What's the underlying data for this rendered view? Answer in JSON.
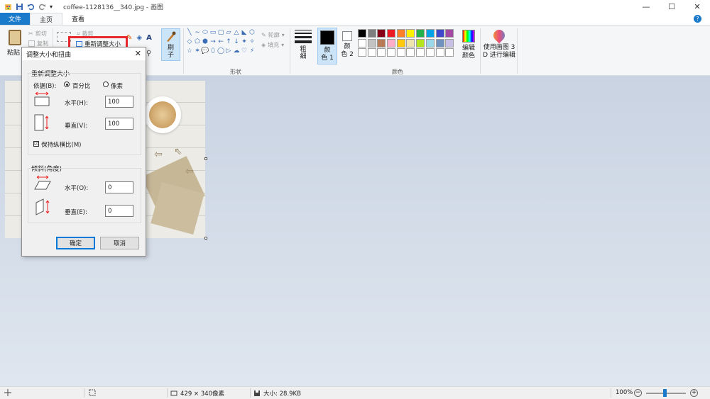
{
  "window": {
    "title": "coffee-1128136__340.jpg - 画图",
    "minimize": "—",
    "maximize": "☐",
    "close": "✕"
  },
  "tabs": {
    "file": "文件",
    "home": "主页",
    "view": "查看",
    "help": "?"
  },
  "ribbon": {
    "paste": "粘贴",
    "cut": "剪切",
    "copy": "复制",
    "crop": "裁剪",
    "resize": "重新调整大小",
    "brush": "刷\n子",
    "brush_arrow": "▾",
    "outline": "轮廓",
    "fill": "填充",
    "thickness": "粗\n细",
    "color1": "颜\n色 1",
    "color2": "颜\n色 2",
    "edit_colors": "编辑\n颜色",
    "paint3d": "使用画图 3\nD 进行编辑",
    "group_shapes": "形状",
    "group_colors": "颜色",
    "palette": [
      "#000000",
      "#7f7f7f",
      "#880015",
      "#ed1c24",
      "#ff7f27",
      "#fff200",
      "#22b14c",
      "#00a2e8",
      "#3f48cc",
      "#a349a4",
      "#ffffff",
      "#c3c3c3",
      "#b97a57",
      "#ffaec9",
      "#ffc90e",
      "#efe4b0",
      "#b5e61d",
      "#99d9ea",
      "#7092be",
      "#c8bfe7",
      "#ffffff",
      "#ffffff",
      "#ffffff",
      "#ffffff",
      "#ffffff",
      "#ffffff",
      "#ffffff",
      "#ffffff",
      "#ffffff",
      "#ffffff"
    ],
    "shape_glyphs": [
      "╲",
      "∼",
      "⬭",
      "▭",
      "▢",
      "▱",
      "△",
      "◣",
      "⬡",
      "◇",
      "⬠",
      "⬢",
      "→",
      "←",
      "↑",
      "↓",
      "✦",
      "✧",
      "☆",
      "✶",
      "💬",
      "⬯",
      "◯",
      "▷",
      "☁",
      "♡",
      "⚡"
    ]
  },
  "dialog": {
    "title": "调整大小和扭曲",
    "close": "✕",
    "resize_section": "重新调整大小",
    "by_label": "依据(B):",
    "percent": "百分比",
    "pixels": "像素",
    "horizontal": "水平(H):",
    "vertical": "垂直(V):",
    "h_value": "100",
    "v_value": "100",
    "keep_ratio": "保持纵横比(M)",
    "keep_ratio_checked": "☑",
    "skew_section": "倾斜(角度)",
    "skew_h": "水平(O):",
    "skew_v": "垂直(E):",
    "skew_h_value": "0",
    "skew_v_value": "0",
    "ok": "确定",
    "cancel": "取消"
  },
  "status": {
    "dimensions": "429 × 340像素",
    "size": "大小: 28.9KB",
    "zoom": "100%",
    "zoom_out": "−",
    "zoom_in": "+"
  }
}
